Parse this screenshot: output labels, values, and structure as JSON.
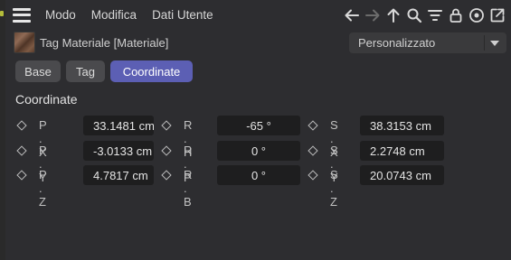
{
  "menu": {
    "items": [
      "Modo",
      "Modifica",
      "Dati Utente"
    ]
  },
  "toolbar": {
    "icons": [
      "arrow-left-icon",
      "arrow-right-icon",
      "arrow-up-icon",
      "search-icon",
      "filter-icon",
      "lock-icon",
      "target-icon",
      "open-external-icon"
    ]
  },
  "object": {
    "name": "Tag Materiale [Materiale]",
    "mode": "Personalizzato"
  },
  "tabs": {
    "base": "Base",
    "tag": "Tag",
    "coordinate": "Coordinate",
    "active_color": "#5c5fb4"
  },
  "section": {
    "title": "Coordinate"
  },
  "fields": {
    "px": {
      "label": "P . X",
      "value": "33.1481 cm"
    },
    "py": {
      "label": "P . Y",
      "value": "-3.0133 cm"
    },
    "pz": {
      "label": "P . Z",
      "value": "4.7817 cm"
    },
    "rh": {
      "label": "R . H",
      "value": "-65 °"
    },
    "rp": {
      "label": "R . P",
      "value": "0 °"
    },
    "rb": {
      "label": "R . B",
      "value": "0 °"
    },
    "sx": {
      "label": "S . X",
      "value": "38.3153 cm"
    },
    "sy": {
      "label": "S . Y",
      "value": "2.2748 cm"
    },
    "sz": {
      "label": "S . Z",
      "value": "20.0743 cm"
    }
  }
}
